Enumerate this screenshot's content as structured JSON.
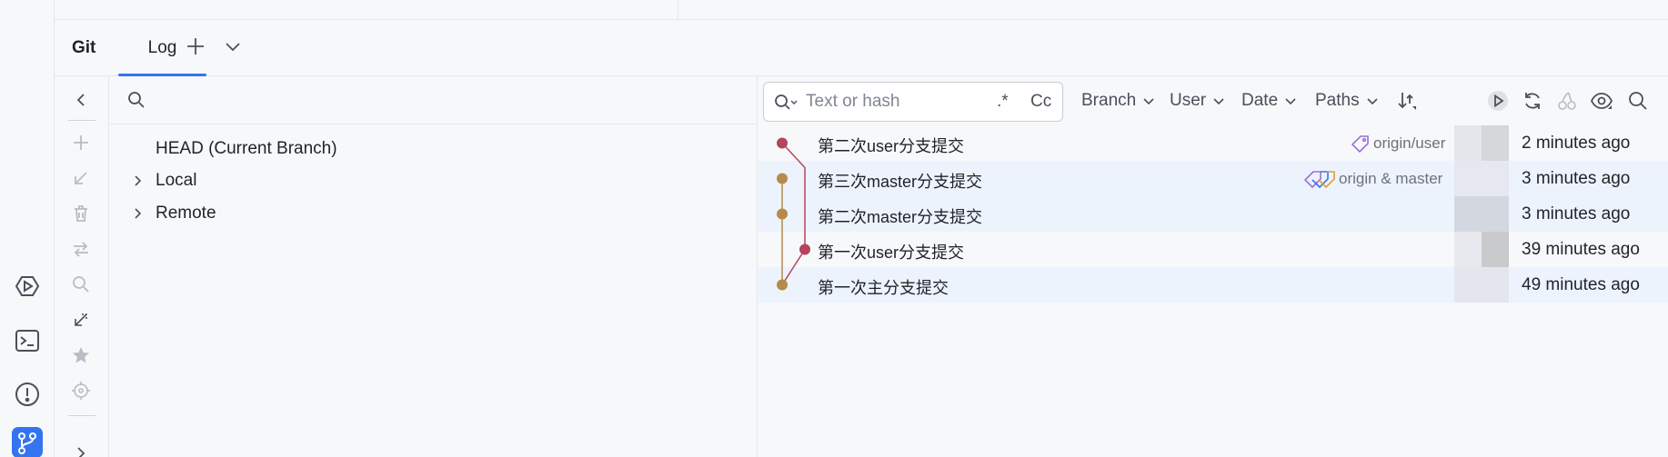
{
  "toolwindow": {
    "title": "Git",
    "tab_label": "Log"
  },
  "branches_tree": {
    "items": [
      {
        "label": "HEAD (Current Branch)",
        "expandable": false
      },
      {
        "label": "Local",
        "expandable": true
      },
      {
        "label": "Remote",
        "expandable": true
      }
    ]
  },
  "log_filters": {
    "search_placeholder": "Text or hash",
    "regex_label": ".*",
    "case_label": "Cc",
    "branch_label": "Branch",
    "user_label": "User",
    "date_label": "Date",
    "paths_label": "Paths"
  },
  "commits": [
    {
      "subject": "第二次user分支提交",
      "ref": "origin/user",
      "date": "2 minutes ago",
      "author_shade": "#e4e6ec",
      "author_shade2": "#d6d7db",
      "node_color": "#b4455c"
    },
    {
      "subject": "第三次master分支提交",
      "ref": "origin & master",
      "date": "3 minutes ago",
      "author_shade": "#e5e8ef",
      "author_shade2": "#e5e8ef",
      "node_color": "#b7894a"
    },
    {
      "subject": "第二次master分支提交",
      "ref": "",
      "date": "3 minutes ago",
      "author_shade": "#d3d7df",
      "author_shade2": "#d3d7df",
      "node_color": "#b7894a"
    },
    {
      "subject": "第一次user分支提交",
      "ref": "",
      "date": "39 minutes ago",
      "author_shade": "#e8e9ee",
      "author_shade2": "#c9cacc",
      "node_color": "#b4455c"
    },
    {
      "subject": "第一次主分支提交",
      "ref": "",
      "date": "49 minutes ago",
      "author_shade": "#e3e6ed",
      "author_shade2": "#e3e6ed",
      "node_color": "#b7894a"
    }
  ],
  "colors": {
    "accent": "#3574f0",
    "user_branch": "#b4455c",
    "master_branch": "#b7894a",
    "selected_row": "#edf3fd"
  }
}
